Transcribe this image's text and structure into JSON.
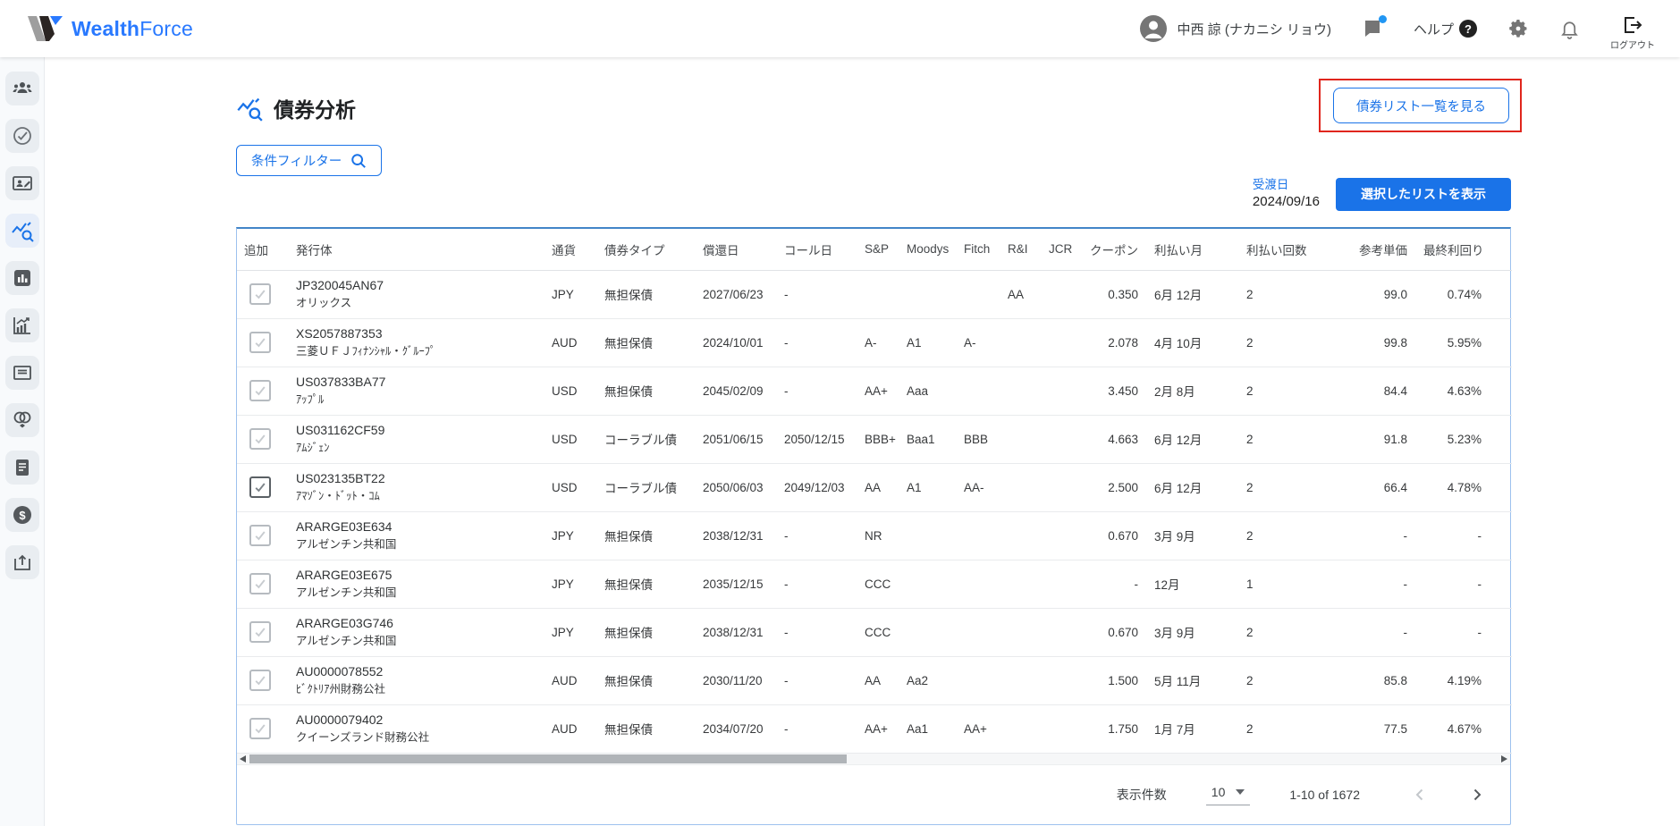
{
  "header": {
    "brand_bold": "Wealth",
    "brand_light": "Force",
    "user_name": "中西 諒 (ナカニシ リョウ)",
    "help_label": "ヘルプ",
    "help_badge": "?",
    "logout_label": "ログアウト"
  },
  "sidebar": {
    "icons": [
      "users-icon",
      "check-circle-icon",
      "contact-edit-icon",
      "bond-analysis-icon",
      "bar-chart-icon",
      "growth-chart-icon",
      "card-icon",
      "rings-icon",
      "document-icon",
      "dollar-icon",
      "export-icon"
    ],
    "active_icon": "bond-analysis-icon"
  },
  "page": {
    "title": "債券分析",
    "filter_button_label": "条件フィルター",
    "view_bond_list_button_label": "債券リスト一覧を見る",
    "settlement_date_label": "受渡日",
    "settlement_date": "2024/09/16",
    "show_selected_button_label": "選択したリストを表示"
  },
  "table": {
    "columns": [
      "追加",
      "発行体",
      "通貨",
      "債券タイプ",
      "償還日",
      "コール日",
      "S&P",
      "Moodys",
      "Fitch",
      "R&I",
      "JCR",
      "クーポン",
      "利払い月",
      "利払い回数",
      "参考単価",
      "最終利回り"
    ],
    "rows": [
      {
        "checked": true,
        "selected": false,
        "code": "JP320045AN67",
        "issuer": "オリックス",
        "currency": "JPY",
        "type": "無担保債",
        "maturity": "2027/06/23",
        "call_date": "-",
        "sp": "",
        "moodys": "",
        "fitch": "",
        "ri": "AA",
        "jcr": "",
        "coupon": "0.350",
        "interest_months": "6月 12月",
        "interest_freq": "2",
        "ref_price": "99.0",
        "ytm": "0.74%"
      },
      {
        "checked": true,
        "selected": false,
        "code": "XS2057887353",
        "issuer": "三菱ＵＦＪﾌｨﾅﾝｼｬﾙ・ｸﾞﾙｰﾌﾟ",
        "currency": "AUD",
        "type": "無担保債",
        "maturity": "2024/10/01",
        "call_date": "-",
        "sp": "A-",
        "moodys": "A1",
        "fitch": "A-",
        "ri": "",
        "jcr": "",
        "coupon": "2.078",
        "interest_months": "4月 10月",
        "interest_freq": "2",
        "ref_price": "99.8",
        "ytm": "5.95%"
      },
      {
        "checked": true,
        "selected": false,
        "code": "US037833BA77",
        "issuer": "ｱｯﾌﾟﾙ",
        "currency": "USD",
        "type": "無担保債",
        "maturity": "2045/02/09",
        "call_date": "-",
        "sp": "AA+",
        "moodys": "Aaa",
        "fitch": "",
        "ri": "",
        "jcr": "",
        "coupon": "3.450",
        "interest_months": "2月 8月",
        "interest_freq": "2",
        "ref_price": "84.4",
        "ytm": "4.63%"
      },
      {
        "checked": true,
        "selected": false,
        "code": "US031162CF59",
        "issuer": "ｱﾑｼﾞｪﾝ",
        "currency": "USD",
        "type": "コーラブル債",
        "maturity": "2051/06/15",
        "call_date": "2050/12/15",
        "sp": "BBB+",
        "moodys": "Baa1",
        "fitch": "BBB",
        "ri": "",
        "jcr": "",
        "coupon": "4.663",
        "interest_months": "6月 12月",
        "interest_freq": "2",
        "ref_price": "91.8",
        "ytm": "5.23%"
      },
      {
        "checked": true,
        "selected": true,
        "code": "US023135BT22",
        "issuer": "ｱﾏｿﾞﾝ・ﾄﾞｯﾄ・ｺﾑ",
        "currency": "USD",
        "type": "コーラブル債",
        "maturity": "2050/06/03",
        "call_date": "2049/12/03",
        "sp": "AA",
        "moodys": "A1",
        "fitch": "AA-",
        "ri": "",
        "jcr": "",
        "coupon": "2.500",
        "interest_months": "6月 12月",
        "interest_freq": "2",
        "ref_price": "66.4",
        "ytm": "4.78%"
      },
      {
        "checked": true,
        "selected": false,
        "code": "ARARGE03E634",
        "issuer": "アルゼンチン共和国",
        "currency": "JPY",
        "type": "無担保債",
        "maturity": "2038/12/31",
        "call_date": "-",
        "sp": "NR",
        "moodys": "",
        "fitch": "",
        "ri": "",
        "jcr": "",
        "coupon": "0.670",
        "interest_months": "3月 9月",
        "interest_freq": "2",
        "ref_price": "-",
        "ytm": "-"
      },
      {
        "checked": true,
        "selected": false,
        "code": "ARARGE03E675",
        "issuer": "アルゼンチン共和国",
        "currency": "JPY",
        "type": "無担保債",
        "maturity": "2035/12/15",
        "call_date": "-",
        "sp": "CCC",
        "moodys": "",
        "fitch": "",
        "ri": "",
        "jcr": "",
        "coupon": "-",
        "interest_months": "12月",
        "interest_freq": "1",
        "ref_price": "-",
        "ytm": "-"
      },
      {
        "checked": true,
        "selected": false,
        "code": "ARARGE03G746",
        "issuer": "アルゼンチン共和国",
        "currency": "JPY",
        "type": "無担保債",
        "maturity": "2038/12/31",
        "call_date": "-",
        "sp": "CCC",
        "moodys": "",
        "fitch": "",
        "ri": "",
        "jcr": "",
        "coupon": "0.670",
        "interest_months": "3月 9月",
        "interest_freq": "2",
        "ref_price": "-",
        "ytm": "-"
      },
      {
        "checked": true,
        "selected": false,
        "code": "AU0000078552",
        "issuer": "ﾋﾞｸﾄﾘｱ州財務公社",
        "currency": "AUD",
        "type": "無担保債",
        "maturity": "2030/11/20",
        "call_date": "-",
        "sp": "AA",
        "moodys": "Aa2",
        "fitch": "",
        "ri": "",
        "jcr": "",
        "coupon": "1.500",
        "interest_months": "5月 11月",
        "interest_freq": "2",
        "ref_price": "85.8",
        "ytm": "4.19%"
      },
      {
        "checked": true,
        "selected": false,
        "code": "AU0000079402",
        "issuer": "クイーンズランド財務公社",
        "currency": "AUD",
        "type": "無担保債",
        "maturity": "2034/07/20",
        "call_date": "-",
        "sp": "AA+",
        "moodys": "Aa1",
        "fitch": "AA+",
        "ri": "",
        "jcr": "",
        "coupon": "1.750",
        "interest_months": "1月 7月",
        "interest_freq": "2",
        "ref_price": "77.5",
        "ytm": "4.67%"
      }
    ]
  },
  "footer": {
    "rows_per_page_label": "表示件数",
    "rows_per_page": "10",
    "range": "1-10 of 1672"
  },
  "colors": {
    "accent_blue": "#1a73e8",
    "brand_blue": "#2979ff",
    "annotation_red": "#e0261d",
    "table_border_blue": "#9dc1ee"
  }
}
